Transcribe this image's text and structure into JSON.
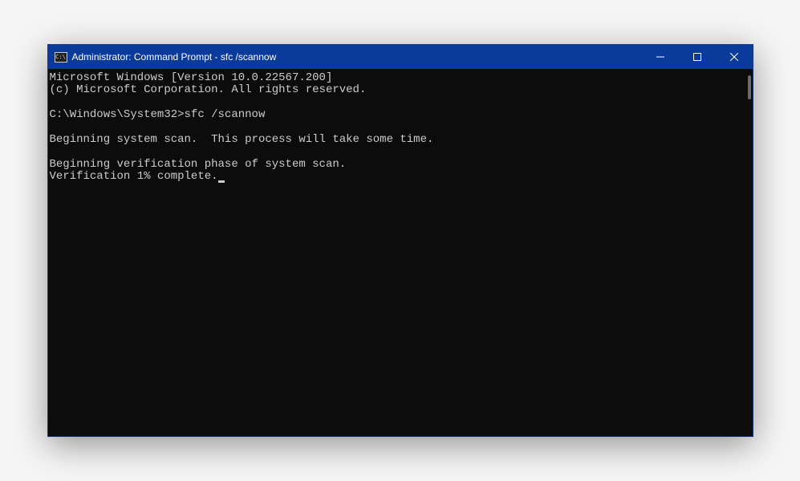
{
  "window": {
    "title": "Administrator: Command Prompt - sfc  /scannow",
    "icon_label": "C:\\"
  },
  "terminal": {
    "line1": "Microsoft Windows [Version 10.0.22567.200]",
    "line2": "(c) Microsoft Corporation. All rights reserved.",
    "blank1": "",
    "prompt_line": "C:\\Windows\\System32>sfc /scannow",
    "blank2": "",
    "line5": "Beginning system scan.  This process will take some time.",
    "blank3": "",
    "line7": "Beginning verification phase of system scan.",
    "line8": "Verification 1% complete."
  }
}
